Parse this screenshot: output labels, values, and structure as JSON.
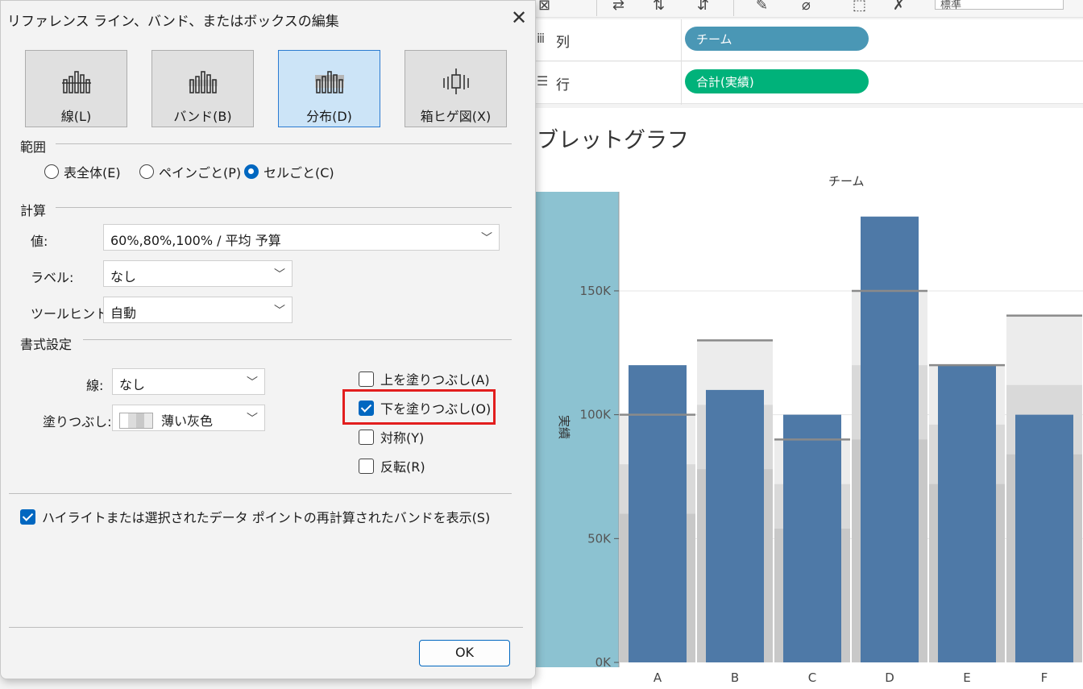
{
  "background": {
    "toolbar_select_value": "標準",
    "columns_shelf": {
      "label": "列",
      "pill": "チーム",
      "pill_color": "#4a97b5"
    },
    "rows_shelf": {
      "label": "行",
      "pill": "合計(実績)",
      "pill_color": "#00b27a"
    },
    "sheet_title": "ブレットグラフ",
    "column_header": "チーム"
  },
  "dialog": {
    "title": "リファレンス ライン、バンド、またはボックスの編集",
    "close_glyph": "✕",
    "types": [
      {
        "label": "線(L)",
        "selected": false
      },
      {
        "label": "バンド(B)",
        "selected": false
      },
      {
        "label": "分布(D)",
        "selected": true
      },
      {
        "label": "箱ヒゲ図(X)",
        "selected": false
      }
    ],
    "scope": {
      "heading": "範囲",
      "options": [
        "表全体(E)",
        "ペインごと(P)",
        "セルごと(C)"
      ],
      "selected_index": 2
    },
    "computation": {
      "heading": "計算",
      "value_label": "値:",
      "value": "60%,80%,100% / 平均 予算",
      "label_label": "ラベル:",
      "label_value": "なし",
      "tooltip_label": "ツールヒント:",
      "tooltip_value": "自動"
    },
    "formatting": {
      "heading": "書式設定",
      "line_label": "線:",
      "line_value": "なし",
      "fill_label": "塗りつぶし:",
      "fill_value": "薄い灰色",
      "fill_above": {
        "label": "上を塗りつぶし(A)",
        "checked": false
      },
      "fill_below": {
        "label": "下を塗りつぶし(O)",
        "checked": true
      },
      "symmetric": {
        "label": "対称(Y)",
        "checked": false
      },
      "reverse": {
        "label": "反転(R)",
        "checked": false
      }
    },
    "recalc": {
      "label": "ハイライトまたは選択されたデータ ポイントの再計算されたバンドを表示(S)",
      "checked": true
    },
    "ok_label": "OK",
    "highlight_color": "#e21e1e"
  },
  "chart_data": {
    "type": "bar",
    "categories": [
      "A",
      "B",
      "C",
      "D",
      "E",
      "F"
    ],
    "series": [
      {
        "values": [
          120000,
          110000,
          100000,
          180000,
          120000,
          100000
        ]
      }
    ],
    "reference_lines": [
      100000,
      130000,
      90000,
      150000,
      120000,
      140000
    ],
    "ylabel": "実績",
    "xlabel": "チーム",
    "ylim": [
      0,
      190000
    ],
    "yticks": [
      "0K",
      "50K",
      "100K",
      "150K"
    ],
    "bar_color": "#4e79a7"
  }
}
